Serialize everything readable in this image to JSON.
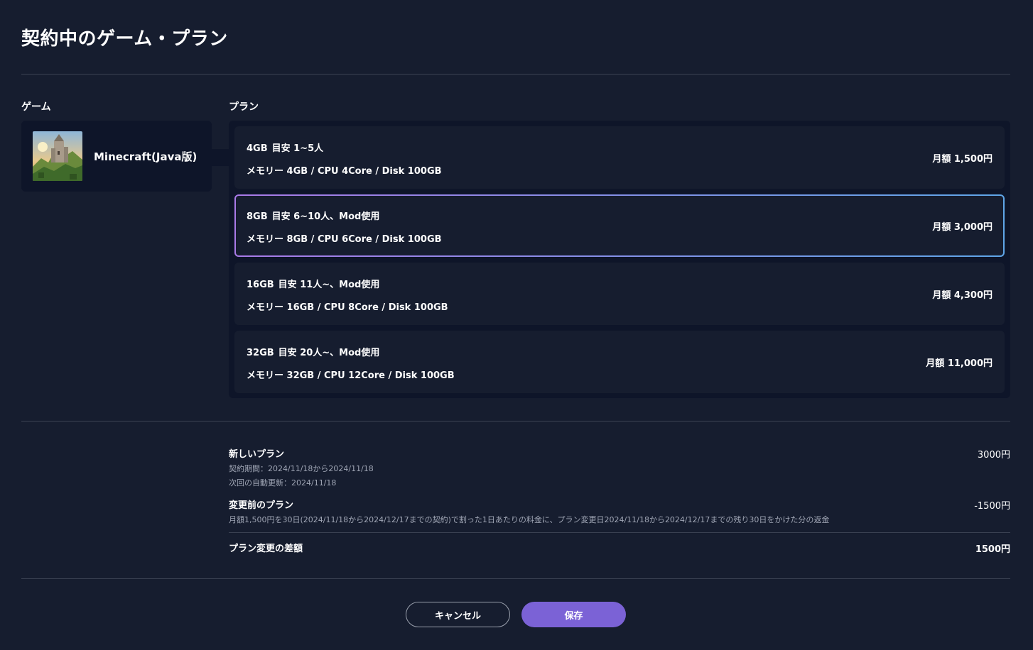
{
  "header": {
    "title": "契約中のゲーム・プラン"
  },
  "game_section": {
    "label": "ゲーム",
    "game": {
      "name": "Minecraft(Java版)",
      "thumbnail_icon": "minecraft-castle-thumbnail"
    }
  },
  "plan_section": {
    "label": "プラン",
    "selected_index": 1,
    "plans": [
      {
        "memory": "4GB",
        "desc": "目安 1~5人",
        "spec": "メモリー 4GB / CPU 4Core / Disk 100GB",
        "price": "月額 1,500円"
      },
      {
        "memory": "8GB",
        "desc": "目安 6~10人、Mod使用",
        "spec": "メモリー 8GB / CPU 6Core / Disk 100GB",
        "price": "月額 3,000円"
      },
      {
        "memory": "16GB",
        "desc": "目安 11人~、Mod使用",
        "spec": "メモリー 16GB / CPU 8Core / Disk 100GB",
        "price": "月額 4,300円"
      },
      {
        "memory": "32GB",
        "desc": "目安 20人~、Mod使用",
        "spec": "メモリー 32GB / CPU 12Core / Disk 100GB",
        "price": "月額 11,000円"
      }
    ]
  },
  "summary": {
    "new_plan": {
      "label": "新しいプラン",
      "period": "契約期間：2024/11/18から2024/11/18",
      "next_renewal": "次回の自動更新：2024/11/18",
      "value": "3000円"
    },
    "old_plan": {
      "label": "変更前のプラン",
      "note": "月額1,500円を30日(2024/11/18から2024/12/17までの契約)で割った1日あたりの料金に、プラン変更日2024/11/18から2024/12/17までの残り30日をかけた分の返金",
      "value": "-1500円"
    },
    "difference": {
      "label": "プラン変更の差額",
      "value": "1500円"
    }
  },
  "actions": {
    "cancel_label": "キャンセル",
    "save_label": "保存"
  },
  "colors": {
    "background": "#161d2f",
    "panel": "#0e1529",
    "accent": "#7b62d6",
    "selected_border_start": "#a97ae8",
    "selected_border_end": "#5fa6e8"
  }
}
